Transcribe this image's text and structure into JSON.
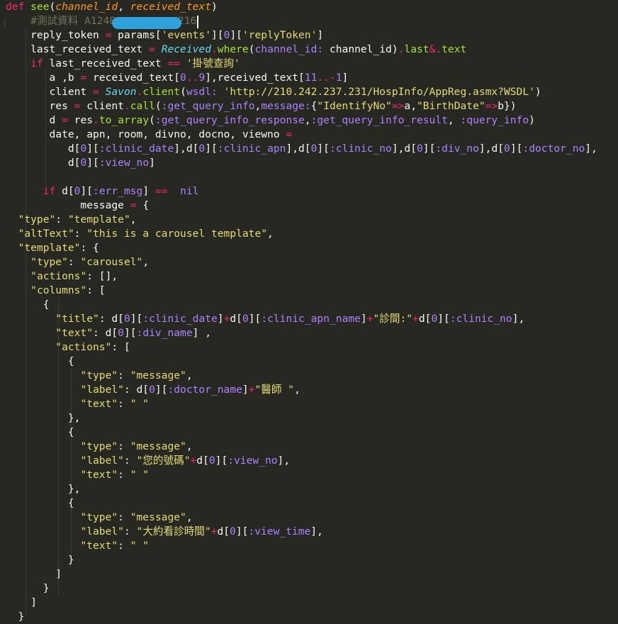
{
  "editor": {
    "colors": {
      "background": "#272822",
      "keyword": "#f92672",
      "function": "#a6e22e",
      "parameter": "#fd971f",
      "string": "#e6db74",
      "symbol": "#ae81ff",
      "class": "#66d9ef",
      "comment": "#75715e",
      "text": "#f8f8f2",
      "redaction": "#2ea8e6"
    },
    "lines": [
      [
        [
          "kw",
          "def"
        ],
        [
          "plain",
          " "
        ],
        [
          "fn",
          "see"
        ],
        [
          "plain",
          "("
        ],
        [
          "param",
          "channel_id"
        ],
        [
          "plain",
          ", "
        ],
        [
          "param",
          "received_text"
        ],
        [
          "plain",
          ")"
        ]
      ],
      [
        [
          "plain",
          "    "
        ],
        [
          "cmt",
          "#測試資料 A1248"
        ],
        [
          "plain",
          "          "
        ],
        [
          "cmt",
          "216"
        ]
      ],
      [
        [
          "plain",
          "    reply_token "
        ],
        [
          "kw",
          "="
        ],
        [
          "plain",
          " params["
        ],
        [
          "str",
          "'events'"
        ],
        [
          "plain",
          "]["
        ],
        [
          "num",
          "0"
        ],
        [
          "plain",
          "]["
        ],
        [
          "str",
          "'replyToken'"
        ],
        [
          "plain",
          "]"
        ]
      ],
      [
        [
          "plain",
          "    last_received_text "
        ],
        [
          "kw",
          "="
        ],
        [
          "plain",
          " "
        ],
        [
          "cls",
          "Received"
        ],
        [
          "kw",
          "."
        ],
        [
          "fn",
          "where"
        ],
        [
          "plain",
          "("
        ],
        [
          "sym",
          "channel_id:"
        ],
        [
          "plain",
          " channel_id)"
        ],
        [
          "kw",
          "."
        ],
        [
          "fn",
          "last"
        ],
        [
          "kw",
          "&."
        ],
        [
          "fn",
          "text"
        ]
      ],
      [
        [
          "plain",
          "    "
        ],
        [
          "kw",
          "if"
        ],
        [
          "plain",
          " last_received_text "
        ],
        [
          "kw",
          "=="
        ],
        [
          "plain",
          " "
        ],
        [
          "str",
          "'掛號查詢'"
        ]
      ],
      [
        [
          "plain",
          "       a ,b "
        ],
        [
          "kw",
          "="
        ],
        [
          "plain",
          " received_text["
        ],
        [
          "num",
          "0"
        ],
        [
          "kw",
          ".."
        ],
        [
          "num",
          "9"
        ],
        [
          "plain",
          "],received_text["
        ],
        [
          "num",
          "11"
        ],
        [
          "kw",
          ".."
        ],
        [
          "kw",
          "-"
        ],
        [
          "num",
          "1"
        ],
        [
          "plain",
          "]"
        ]
      ],
      [
        [
          "plain",
          "       client "
        ],
        [
          "kw",
          "="
        ],
        [
          "plain",
          " "
        ],
        [
          "cls",
          "Savon"
        ],
        [
          "kw",
          "."
        ],
        [
          "fn",
          "client"
        ],
        [
          "plain",
          "("
        ],
        [
          "sym",
          "wsdl:"
        ],
        [
          "plain",
          " "
        ],
        [
          "str",
          "'http://210.242.237.231/HospInfo/AppReg.asmx?WSDL'"
        ],
        [
          "plain",
          ")"
        ]
      ],
      [
        [
          "plain",
          "       res "
        ],
        [
          "kw",
          "="
        ],
        [
          "plain",
          " client"
        ],
        [
          "kw",
          "."
        ],
        [
          "fn",
          "call"
        ],
        [
          "plain",
          "("
        ],
        [
          "sym",
          ":get_query_info"
        ],
        [
          "plain",
          ","
        ],
        [
          "sym",
          "message:"
        ],
        [
          "plain",
          "{"
        ],
        [
          "str",
          "\"IdentifyNo\""
        ],
        [
          "kw",
          "=>"
        ],
        [
          "plain",
          "a,"
        ],
        [
          "str",
          "\"BirthDate\""
        ],
        [
          "kw",
          "=>"
        ],
        [
          "plain",
          "b})"
        ]
      ],
      [
        [
          "plain",
          "       d "
        ],
        [
          "kw",
          "="
        ],
        [
          "plain",
          " res"
        ],
        [
          "kw",
          "."
        ],
        [
          "fn",
          "to_array"
        ],
        [
          "plain",
          "("
        ],
        [
          "sym",
          ":get_query_info_response"
        ],
        [
          "plain",
          ","
        ],
        [
          "sym",
          ":get_query_info_result"
        ],
        [
          "plain",
          ", "
        ],
        [
          "sym",
          ":query_info"
        ],
        [
          "plain",
          ")"
        ]
      ],
      [
        [
          "plain",
          "       date, apn, room, divno, docno, viewno "
        ],
        [
          "kw",
          "="
        ]
      ],
      [
        [
          "plain",
          "          d["
        ],
        [
          "num",
          "0"
        ],
        [
          "plain",
          "]["
        ],
        [
          "sym",
          ":clinic_date"
        ],
        [
          "plain",
          "],d["
        ],
        [
          "num",
          "0"
        ],
        [
          "plain",
          "]["
        ],
        [
          "sym",
          ":clinic_apn"
        ],
        [
          "plain",
          "],d["
        ],
        [
          "num",
          "0"
        ],
        [
          "plain",
          "]["
        ],
        [
          "sym",
          ":clinic_no"
        ],
        [
          "plain",
          "],d["
        ],
        [
          "num",
          "0"
        ],
        [
          "plain",
          "]["
        ],
        [
          "sym",
          ":div_no"
        ],
        [
          "plain",
          "],d["
        ],
        [
          "num",
          "0"
        ],
        [
          "plain",
          "]["
        ],
        [
          "sym",
          ":doctor_no"
        ],
        [
          "plain",
          "],"
        ]
      ],
      [
        [
          "plain",
          "          d["
        ],
        [
          "num",
          "0"
        ],
        [
          "plain",
          "]["
        ],
        [
          "sym",
          ":view_no"
        ],
        [
          "plain",
          "]"
        ]
      ],
      [],
      [
        [
          "plain",
          "      "
        ],
        [
          "kw",
          "if"
        ],
        [
          "plain",
          " d["
        ],
        [
          "num",
          "0"
        ],
        [
          "plain",
          "]["
        ],
        [
          "sym",
          ":err_msg"
        ],
        [
          "plain",
          "] "
        ],
        [
          "kw",
          "=="
        ],
        [
          "plain",
          "  "
        ],
        [
          "const",
          "nil"
        ]
      ],
      [
        [
          "plain",
          "            message "
        ],
        [
          "kw",
          "="
        ],
        [
          "plain",
          " {"
        ]
      ],
      [
        [
          "plain",
          "  "
        ],
        [
          "str",
          "\"type\""
        ],
        [
          "plain",
          ": "
        ],
        [
          "str",
          "\"template\""
        ],
        [
          "plain",
          ","
        ]
      ],
      [
        [
          "plain",
          "  "
        ],
        [
          "str",
          "\"altText\""
        ],
        [
          "plain",
          ": "
        ],
        [
          "str",
          "\"this is a carousel template\""
        ],
        [
          "plain",
          ","
        ]
      ],
      [
        [
          "plain",
          "  "
        ],
        [
          "str",
          "\"template\""
        ],
        [
          "plain",
          ": {"
        ]
      ],
      [
        [
          "plain",
          "    "
        ],
        [
          "str",
          "\"type\""
        ],
        [
          "plain",
          ": "
        ],
        [
          "str",
          "\"carousel\""
        ],
        [
          "plain",
          ","
        ]
      ],
      [
        [
          "plain",
          "    "
        ],
        [
          "str",
          "\"actions\""
        ],
        [
          "plain",
          ": [],"
        ]
      ],
      [
        [
          "plain",
          "    "
        ],
        [
          "str",
          "\"columns\""
        ],
        [
          "plain",
          ": ["
        ]
      ],
      [
        [
          "plain",
          "      {"
        ]
      ],
      [
        [
          "plain",
          "        "
        ],
        [
          "str",
          "\"title\""
        ],
        [
          "plain",
          ": d["
        ],
        [
          "num",
          "0"
        ],
        [
          "plain",
          "]["
        ],
        [
          "sym",
          ":clinic_date"
        ],
        [
          "plain",
          "]"
        ],
        [
          "kw",
          "+"
        ],
        [
          "plain",
          "d["
        ],
        [
          "num",
          "0"
        ],
        [
          "plain",
          "]["
        ],
        [
          "sym",
          ":clinic_apn_name"
        ],
        [
          "plain",
          "]"
        ],
        [
          "kw",
          "+"
        ],
        [
          "str",
          "\"診間:\""
        ],
        [
          "kw",
          "+"
        ],
        [
          "plain",
          "d["
        ],
        [
          "num",
          "0"
        ],
        [
          "plain",
          "]["
        ],
        [
          "sym",
          ":clinic_no"
        ],
        [
          "plain",
          "],"
        ]
      ],
      [
        [
          "plain",
          "        "
        ],
        [
          "str",
          "\"text\""
        ],
        [
          "plain",
          ": d["
        ],
        [
          "num",
          "0"
        ],
        [
          "plain",
          "]["
        ],
        [
          "sym",
          ":div_name"
        ],
        [
          "plain",
          "] ,"
        ]
      ],
      [
        [
          "plain",
          "        "
        ],
        [
          "str",
          "\"actions\""
        ],
        [
          "plain",
          ": ["
        ]
      ],
      [
        [
          "plain",
          "          {"
        ]
      ],
      [
        [
          "plain",
          "            "
        ],
        [
          "str",
          "\"type\""
        ],
        [
          "plain",
          ": "
        ],
        [
          "str",
          "\"message\""
        ],
        [
          "plain",
          ","
        ]
      ],
      [
        [
          "plain",
          "            "
        ],
        [
          "str",
          "\"label\""
        ],
        [
          "plain",
          ": d["
        ],
        [
          "num",
          "0"
        ],
        [
          "plain",
          "]["
        ],
        [
          "sym",
          ":doctor_name"
        ],
        [
          "plain",
          "]"
        ],
        [
          "kw",
          "+"
        ],
        [
          "str",
          "\"醫師 \""
        ],
        [
          "plain",
          ","
        ]
      ],
      [
        [
          "plain",
          "            "
        ],
        [
          "str",
          "\"text\""
        ],
        [
          "plain",
          ": "
        ],
        [
          "str",
          "\" \""
        ]
      ],
      [
        [
          "plain",
          "          },"
        ]
      ],
      [
        [
          "plain",
          "          {"
        ]
      ],
      [
        [
          "plain",
          "            "
        ],
        [
          "str",
          "\"type\""
        ],
        [
          "plain",
          ": "
        ],
        [
          "str",
          "\"message\""
        ],
        [
          "plain",
          ","
        ]
      ],
      [
        [
          "plain",
          "            "
        ],
        [
          "str",
          "\"label\""
        ],
        [
          "plain",
          ": "
        ],
        [
          "str",
          "\"您的號碼\""
        ],
        [
          "kw",
          "+"
        ],
        [
          "plain",
          "d["
        ],
        [
          "num",
          "0"
        ],
        [
          "plain",
          "]["
        ],
        [
          "sym",
          ":view_no"
        ],
        [
          "plain",
          "],"
        ]
      ],
      [
        [
          "plain",
          "            "
        ],
        [
          "str",
          "\"text\""
        ],
        [
          "plain",
          ": "
        ],
        [
          "str",
          "\" \""
        ]
      ],
      [
        [
          "plain",
          "          },"
        ]
      ],
      [
        [
          "plain",
          "          {"
        ]
      ],
      [
        [
          "plain",
          "            "
        ],
        [
          "str",
          "\"type\""
        ],
        [
          "plain",
          ": "
        ],
        [
          "str",
          "\"message\""
        ],
        [
          "plain",
          ","
        ]
      ],
      [
        [
          "plain",
          "            "
        ],
        [
          "str",
          "\"label\""
        ],
        [
          "plain",
          ": "
        ],
        [
          "str",
          "\"大約看診時間\""
        ],
        [
          "kw",
          "+"
        ],
        [
          "plain",
          "d["
        ],
        [
          "num",
          "0"
        ],
        [
          "plain",
          "]["
        ],
        [
          "sym",
          ":view_time"
        ],
        [
          "plain",
          "],"
        ]
      ],
      [
        [
          "plain",
          "            "
        ],
        [
          "str",
          "\"text\""
        ],
        [
          "plain",
          ": "
        ],
        [
          "str",
          "\" \""
        ]
      ],
      [
        [
          "plain",
          "          }"
        ]
      ],
      [
        [
          "plain",
          "        ]"
        ]
      ],
      [
        [
          "plain",
          "      }"
        ]
      ],
      [
        [
          "plain",
          "    ]"
        ]
      ],
      [
        [
          "plain",
          "  }"
        ]
      ]
    ]
  }
}
